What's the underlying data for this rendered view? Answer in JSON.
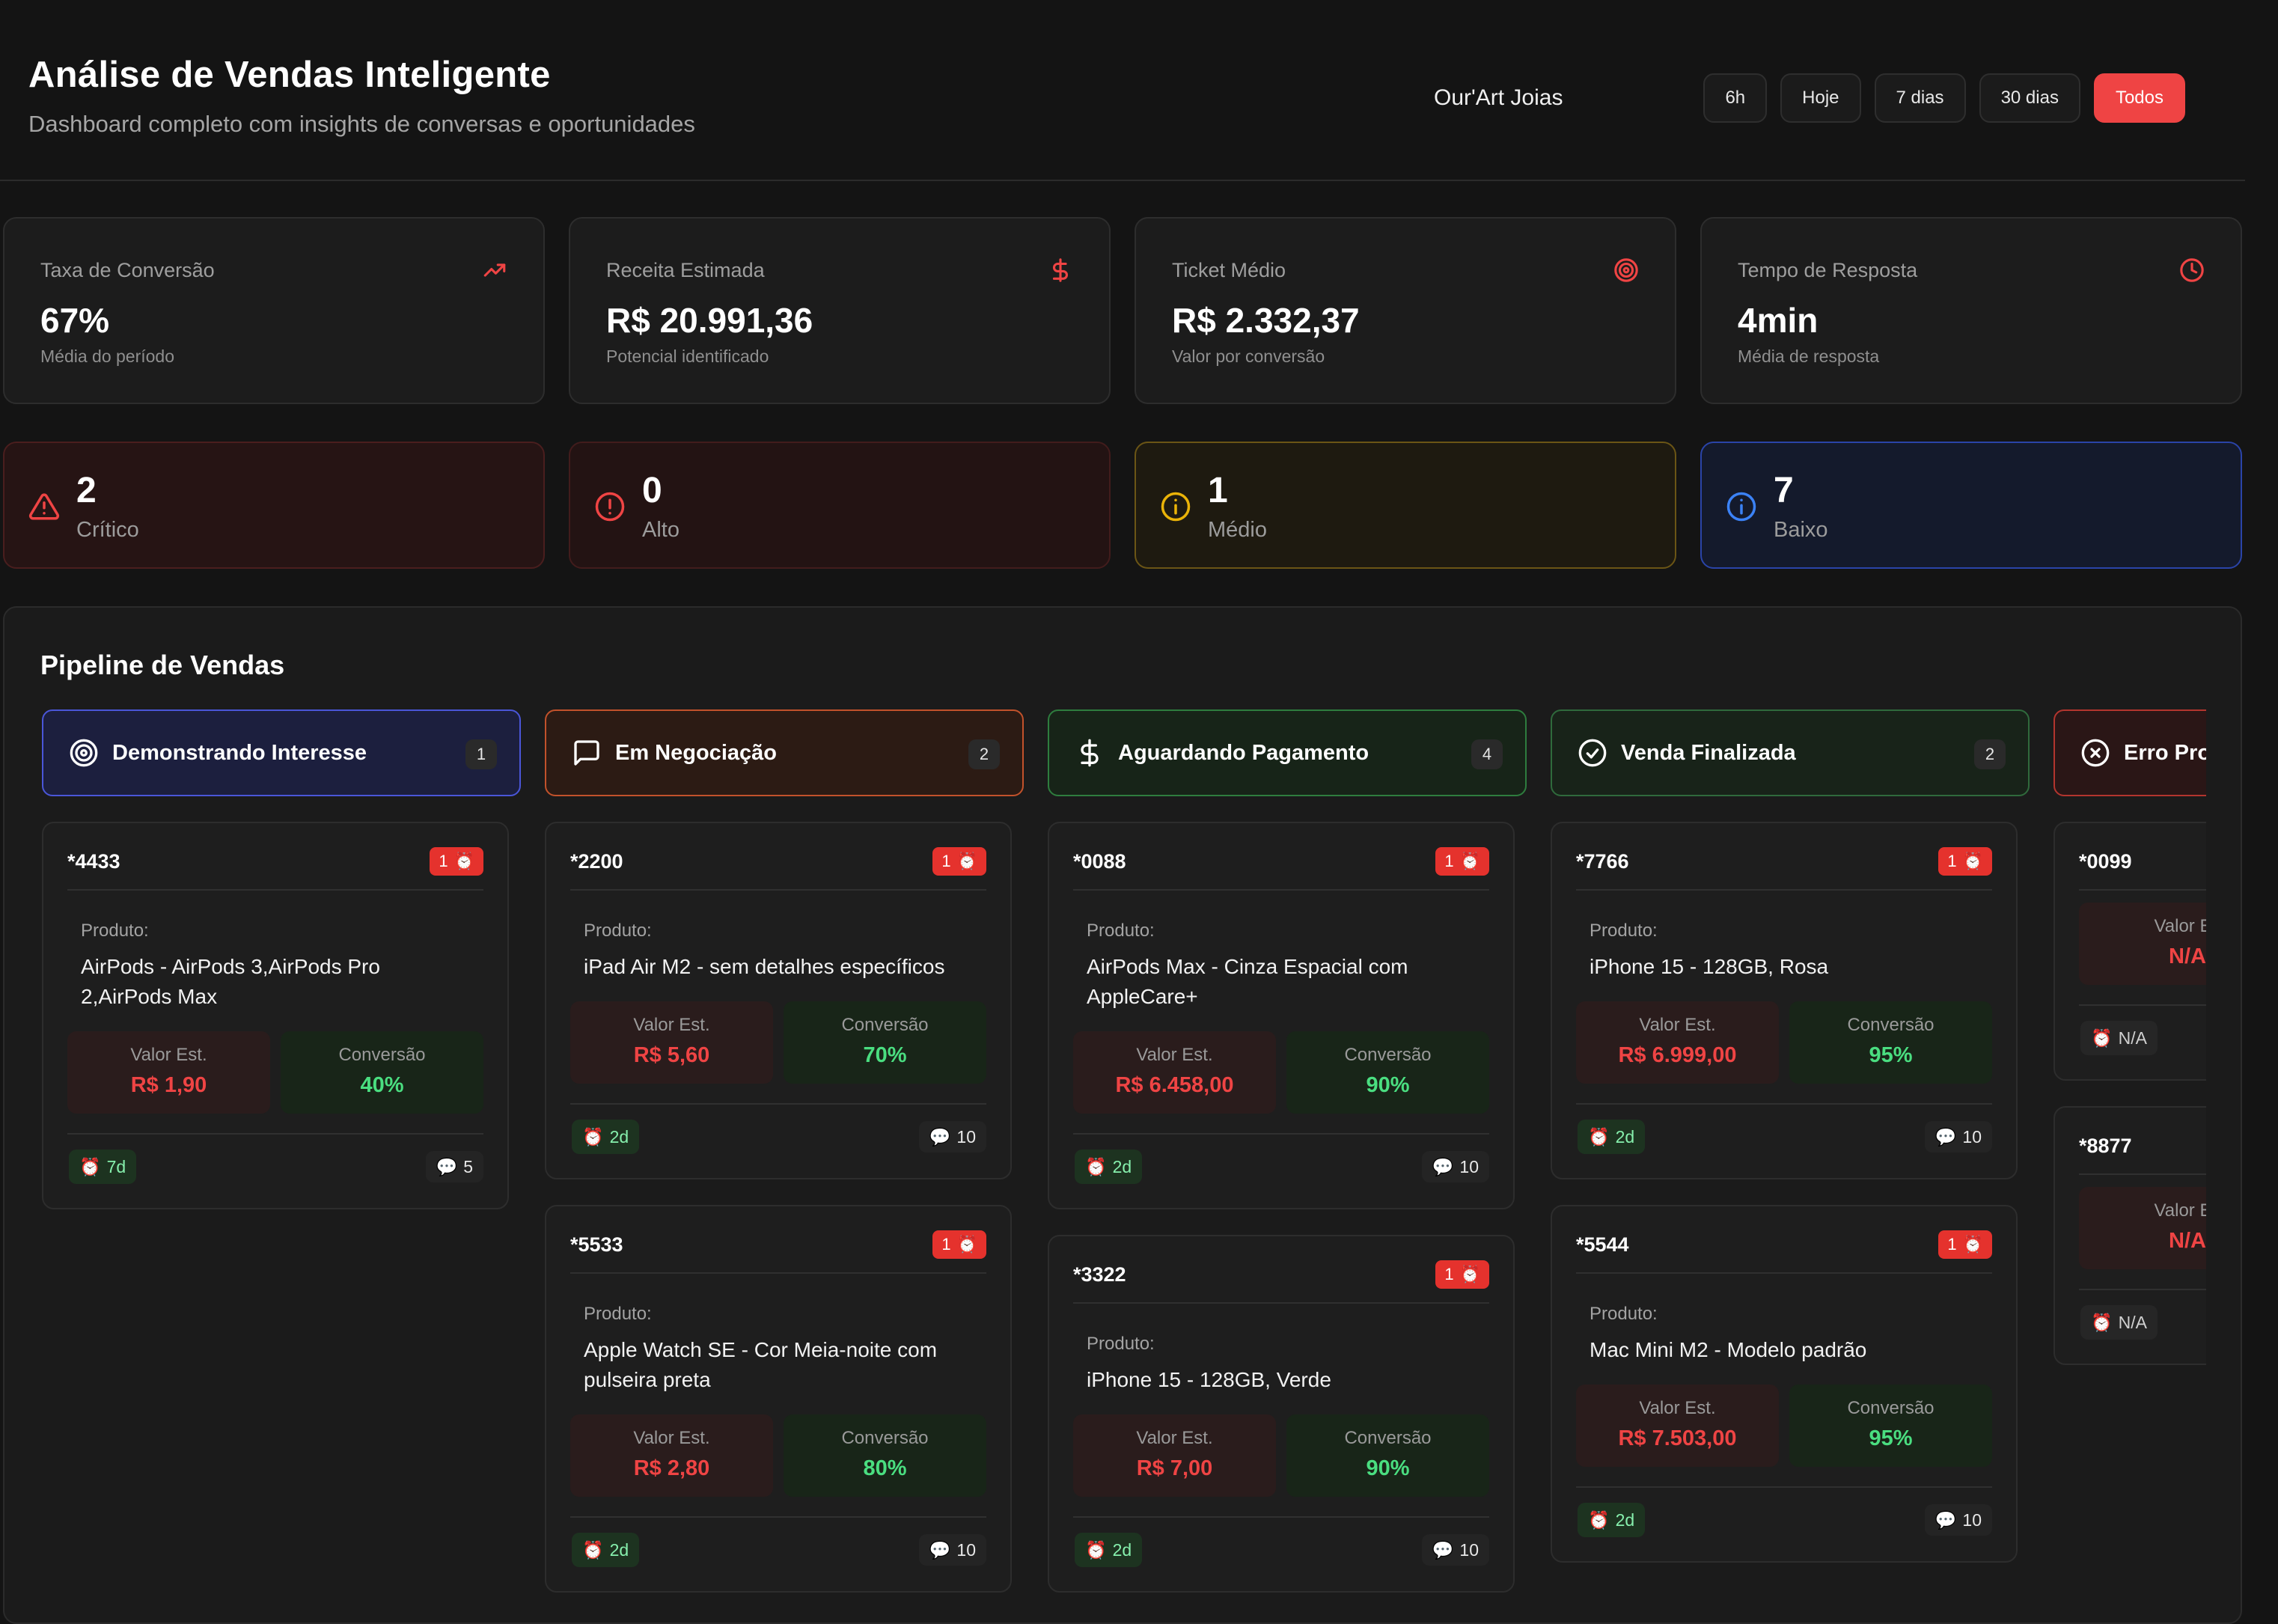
{
  "header": {
    "title": "Análise de Vendas Inteligente",
    "subtitle": "Dashboard completo com insights de conversas e oportunidades",
    "company": "Our'Art Joias",
    "ranges": [
      "6h",
      "Hoje",
      "7 dias",
      "30 dias",
      "Todos"
    ],
    "active_range": "Todos"
  },
  "kpis": [
    {
      "label": "Taxa de Conversão",
      "value": "67%",
      "sub": "Média do período",
      "icon": "trending-up-icon"
    },
    {
      "label": "Receita Estimada",
      "value": "R$ 20.991,36",
      "sub": "Potencial identificado",
      "icon": "dollar-icon"
    },
    {
      "label": "Ticket Médio",
      "value": "R$ 2.332,37",
      "sub": "Valor por conversão",
      "icon": "target-icon"
    },
    {
      "label": "Tempo de Resposta",
      "value": "4min",
      "sub": "Média de resposta",
      "icon": "clock-icon"
    }
  ],
  "priorities": [
    {
      "count": "2",
      "label": "Crítico",
      "icon": "alert-triangle-icon"
    },
    {
      "count": "0",
      "label": "Alto",
      "icon": "alert-circle-icon"
    },
    {
      "count": "1",
      "label": "Médio",
      "icon": "info-icon"
    },
    {
      "count": "7",
      "label": "Baixo",
      "icon": "info-icon"
    }
  ],
  "colors": {
    "accent": "#ef4444",
    "success": "#4ade80",
    "warning": "#eab308",
    "info": "#3b82f6"
  },
  "pipeline": {
    "title": "Pipeline de Vendas",
    "columns": [
      {
        "title": "Demonstrando Interesse",
        "count": "1",
        "icon": "target-icon",
        "cards": [
          {
            "id": "*4433",
            "badge": "1",
            "product_label": "Produto:",
            "product": "AirPods - AirPods 3,AirPods Pro 2,AirPods Max",
            "value_label": "Valor Est.",
            "value": "R$ 1,90",
            "conv_label": "Conversão",
            "conv": "40%",
            "time": "7d",
            "msgs": "5"
          }
        ]
      },
      {
        "title": "Em Negociação",
        "count": "2",
        "icon": "message-square-icon",
        "cards": [
          {
            "id": "*2200",
            "badge": "1",
            "product_label": "Produto:",
            "product": "iPad Air M2 - sem detalhes específicos",
            "value_label": "Valor Est.",
            "value": "R$ 5,60",
            "conv_label": "Conversão",
            "conv": "70%",
            "time": "2d",
            "msgs": "10"
          },
          {
            "id": "*5533",
            "badge": "1",
            "product_label": "Produto:",
            "product": "Apple Watch SE - Cor Meia-noite com pulseira preta",
            "value_label": "Valor Est.",
            "value": "R$ 2,80",
            "conv_label": "Conversão",
            "conv": "80%",
            "time": "2d",
            "msgs": "10"
          }
        ]
      },
      {
        "title": "Aguardando Pagamento",
        "count": "4",
        "icon": "dollar-icon",
        "cards": [
          {
            "id": "*0088",
            "badge": "1",
            "product_label": "Produto:",
            "product": "AirPods Max - Cinza Espacial com AppleCare+",
            "value_label": "Valor Est.",
            "value": "R$ 6.458,00",
            "conv_label": "Conversão",
            "conv": "90%",
            "time": "2d",
            "msgs": "10"
          },
          {
            "id": "*3322",
            "badge": "1",
            "product_label": "Produto:",
            "product": "iPhone 15 - 128GB, Verde",
            "value_label": "Valor Est.",
            "value": "R$ 7,00",
            "conv_label": "Conversão",
            "conv": "90%",
            "time": "2d",
            "msgs": "10"
          }
        ]
      },
      {
        "title": "Venda Finalizada",
        "count": "2",
        "icon": "check-circle-icon",
        "cards": [
          {
            "id": "*7766",
            "badge": "1",
            "product_label": "Produto:",
            "product": "iPhone 15 - 128GB, Rosa",
            "value_label": "Valor Est.",
            "value": "R$ 6.999,00",
            "conv_label": "Conversão",
            "conv": "95%",
            "time": "2d",
            "msgs": "10"
          },
          {
            "id": "*5544",
            "badge": "1",
            "product_label": "Produto:",
            "product": "Mac Mini M2 - Modelo padrão",
            "value_label": "Valor Est.",
            "value": "R$ 7.503,00",
            "conv_label": "Conversão",
            "conv": "95%",
            "time": "2d",
            "msgs": "10"
          }
        ]
      },
      {
        "title": "Erro Pro",
        "count": "",
        "icon": "x-circle-icon",
        "cards": [
          {
            "id": "*0099",
            "value_label": "Valor Es",
            "value": "N/A",
            "time": "N/A"
          },
          {
            "id": "*8877",
            "value_label": "Valor Es",
            "value": "N/A",
            "time": "N/A"
          }
        ]
      }
    ]
  }
}
